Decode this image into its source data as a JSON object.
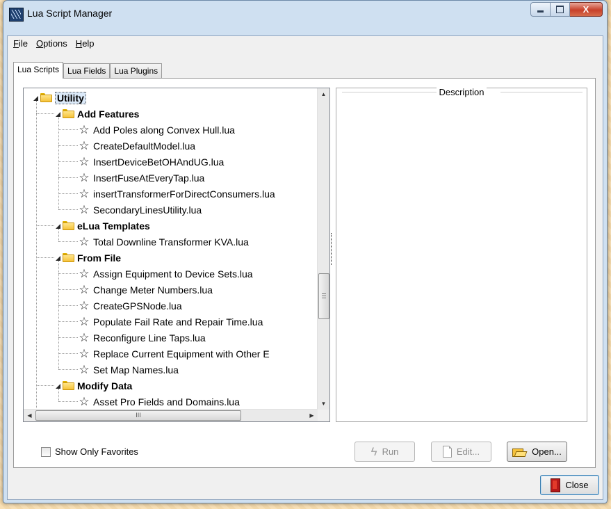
{
  "window": {
    "title": "Lua Script Manager",
    "close_glyph": "X"
  },
  "menu": {
    "items": [
      {
        "acc": "F",
        "rest": "ile"
      },
      {
        "acc": "O",
        "rest": "ptions"
      },
      {
        "acc": "H",
        "rest": "elp"
      }
    ]
  },
  "tabs": [
    "Lua Scripts",
    "Lua Fields",
    "Lua Plugins"
  ],
  "tree": {
    "root": "Utility",
    "groups": [
      {
        "name": "Add Features",
        "items": [
          "Add Poles along Convex Hull.lua",
          "CreateDefaultModel.lua",
          "InsertDeviceBetOHAndUG.lua",
          "InsertFuseAtEveryTap.lua",
          "insertTransformerForDirectConsumers.lua",
          "SecondaryLinesUtility.lua"
        ]
      },
      {
        "name": "eLua Templates",
        "items": [
          "Total Downline Transformer KVA.lua"
        ]
      },
      {
        "name": "From File",
        "items": [
          "Assign Equipment to Device Sets.lua",
          "Change Meter Numbers.lua",
          "CreateGPSNode.lua",
          "Populate Fail Rate and Repair Time.lua",
          "Reconfigure Line Taps.lua",
          "Replace Current Equipment with Other E",
          "Set Map Names.lua"
        ]
      },
      {
        "name": "Modify Data",
        "items": [
          "Asset Pro Fields and Domains.lua"
        ]
      }
    ],
    "hscroll_grip": "III"
  },
  "description": {
    "title": "Description"
  },
  "favorites": {
    "label": "Show Only Favorites",
    "checked": false
  },
  "buttons": {
    "run": "Run",
    "edit": "Edit...",
    "open": "Open...",
    "close": "Close"
  }
}
